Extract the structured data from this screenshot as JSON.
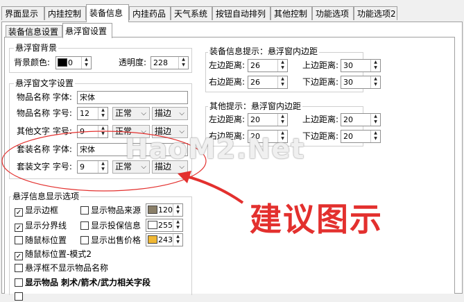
{
  "tabs": [
    "界面显示",
    "内挂控制",
    "装备信息",
    "内挂药品",
    "天气系统",
    "按钮自动排列",
    "其他控制",
    "功能选项",
    "功能选项2"
  ],
  "subtabs": [
    "装备信息设置",
    "悬浮窗设置"
  ],
  "bg_group": {
    "title": "悬浮窗背景",
    "color_label": "背景颜色:",
    "color_value": "0",
    "color_hex": "#000000",
    "opacity_label": "透明度:",
    "opacity_value": "228"
  },
  "text_group": {
    "title": "悬浮窗文字设置",
    "rows": [
      {
        "label": "物品名称",
        "field": "字体:",
        "value": "宋体"
      },
      {
        "label": "物品名称",
        "field": "字号:",
        "value": "12",
        "style": "正常",
        "effect": "描边"
      },
      {
        "label": "其他文字",
        "field": "字号:",
        "value": "9",
        "style": "正常",
        "effect": "描边"
      },
      {
        "label": "套装名称",
        "field": "字体:",
        "value": "宋体"
      },
      {
        "label": "套装文字",
        "field": "字号:",
        "value": "9",
        "style": "正常",
        "effect": "描边"
      }
    ]
  },
  "equip_margin": {
    "title": "装备信息提示：悬浮窗内边距",
    "left_label": "左边距离:",
    "left": "26",
    "top_label": "上边距离:",
    "top": "30",
    "right_label": "右边距离:",
    "right": "26",
    "bottom_label": "下边距离:",
    "bottom": "30"
  },
  "other_margin": {
    "title": "其他提示：悬浮窗内边距",
    "left_label": "左边距离:",
    "left": "20",
    "top_label": "上边距离:",
    "top": "20",
    "right_label": "右边距离:",
    "right": "20",
    "bottom_label": "下边距离:",
    "bottom": "20"
  },
  "display_group": {
    "title": "悬浮信息显示选项",
    "opt_border": "显示边框",
    "opt_sep": "显示分界线",
    "opt_follow": "随鼠标位置",
    "opt_follow2": "随鼠标位置-模式2",
    "opt_hide_name": "悬浮框不显示物品名称",
    "opt_fields": "显示物品 刺术/箭术/武力相关字段",
    "opt_source": "显示物品来源",
    "opt_insure": "显示投保信息",
    "opt_price": "显示出售价格",
    "source_val": "120",
    "source_color": "#8a7f68",
    "insure_val": "255",
    "insure_color": "#ffffff",
    "price_val": "243",
    "price_color": "#f0b733"
  },
  "overlay": {
    "watermark": "HaoM2.Net",
    "suggest": "建议图示",
    "accent": "#e3302e"
  }
}
